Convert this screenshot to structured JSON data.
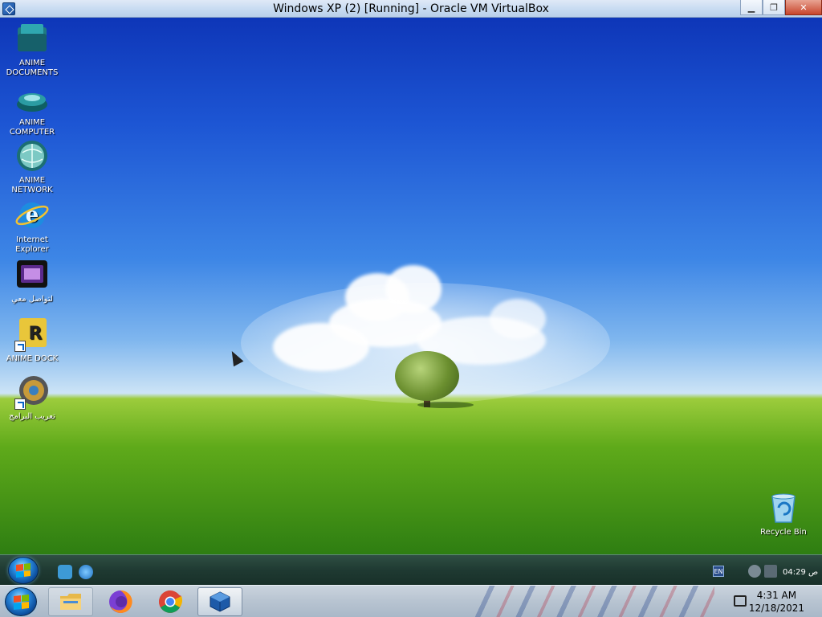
{
  "host_window": {
    "title": "Windows XP (2) [Running] - Oracle VM VirtualBox",
    "buttons": {
      "minimize": "▁",
      "restore": "❐",
      "close": "✕"
    }
  },
  "desktop_icons": [
    {
      "label_line1": "ANIME",
      "label_line2": "DOCUMENTS",
      "icon": "folder-documents-icon"
    },
    {
      "label_line1": "ANIME",
      "label_line2": "COMPUTER",
      "icon": "computer-icon"
    },
    {
      "label_line1": "ANIME",
      "label_line2": "NETWORK",
      "icon": "network-globe-icon"
    },
    {
      "label_line1": "Internet",
      "label_line2": "Explorer",
      "icon": "internet-explorer-icon"
    },
    {
      "label_line1": "لتواصل معي",
      "label_line2": "",
      "icon": "media-box-icon"
    },
    {
      "label_line1": "ANIME DOCK",
      "label_line2": "",
      "icon": "anime-dock-icon"
    },
    {
      "label_line1": "تعريب البرامج",
      "label_line2": "",
      "icon": "arabize-programs-icon"
    }
  ],
  "recycle_bin": {
    "label": "Recycle Bin",
    "icon": "recycle-bin-icon"
  },
  "guest_taskbar": {
    "language": "EN",
    "time": "04:29 ص",
    "quick_launch": [
      "show-desktop-icon",
      "internet-explorer-icon"
    ]
  },
  "host_taskbar": {
    "pinned": [
      {
        "name": "file-explorer",
        "icon": "folder-icon",
        "active": false
      },
      {
        "name": "firefox",
        "icon": "firefox-icon",
        "active": false
      },
      {
        "name": "chrome",
        "icon": "chrome-icon",
        "active": false
      },
      {
        "name": "virtualbox",
        "icon": "virtualbox-icon",
        "active": true
      }
    ],
    "clock_time": "4:31 AM",
    "clock_date": "12/18/2021"
  },
  "colors": {
    "sky_top": "#0e36b8",
    "grass": "#5faa1a",
    "guest_taskbar": "#1f3a32",
    "host_taskbar": "#b9c5d2"
  }
}
